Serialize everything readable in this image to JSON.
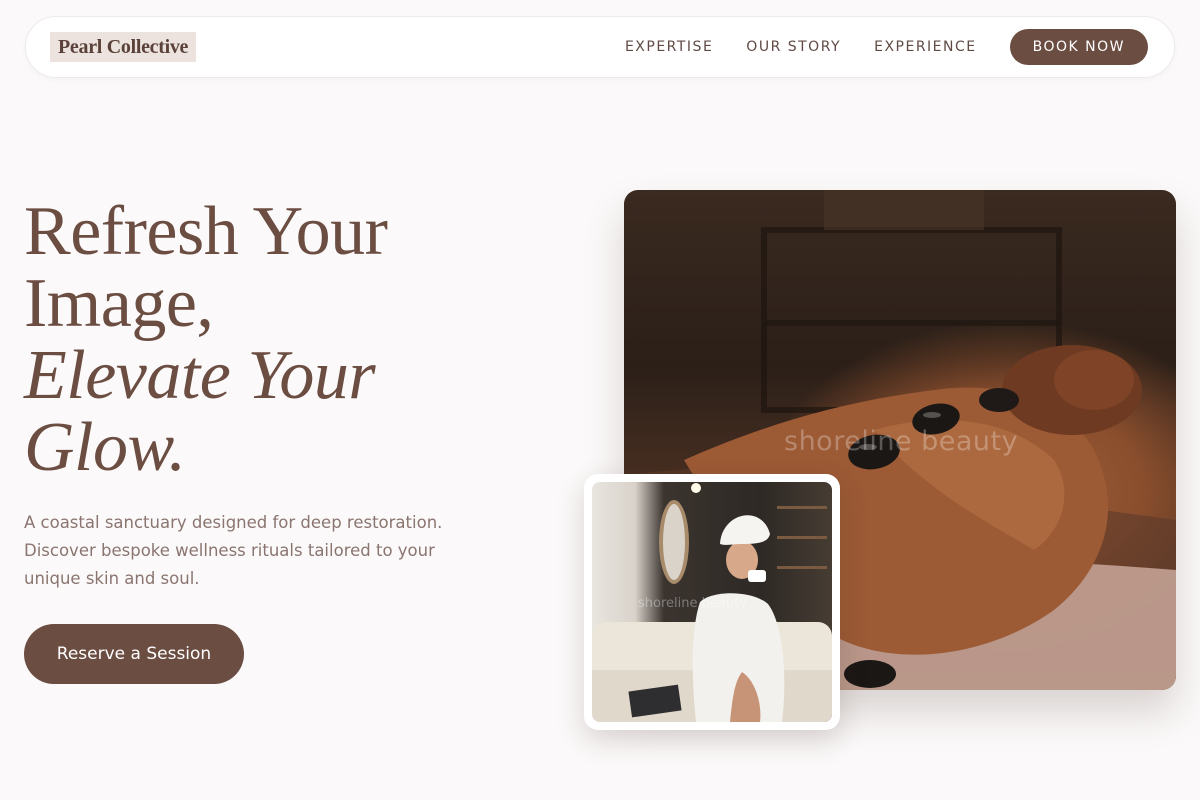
{
  "brand": {
    "name": "Pearl Collective"
  },
  "nav": {
    "links": [
      "EXPERTISE",
      "OUR STORY",
      "EXPERIENCE"
    ],
    "cta": "BOOK NOW"
  },
  "hero": {
    "headline_line1": "Refresh Your",
    "headline_line2": "Image,",
    "headline_line3": "Elevate Your",
    "headline_line4": "Glow.",
    "subtext": "A coastal sanctuary designed for deep restoration. Discover bespoke wellness rituals tailored to your unique skin and soul.",
    "cta": "Reserve a Session"
  },
  "images": {
    "main_watermark": "shoreline beauty",
    "small_watermark": "shoreline beauty"
  },
  "colors": {
    "accent": "#6b4d42",
    "background": "#fbf9f9",
    "logo_bg": "#ece3df",
    "body_text": "#8a7570"
  }
}
